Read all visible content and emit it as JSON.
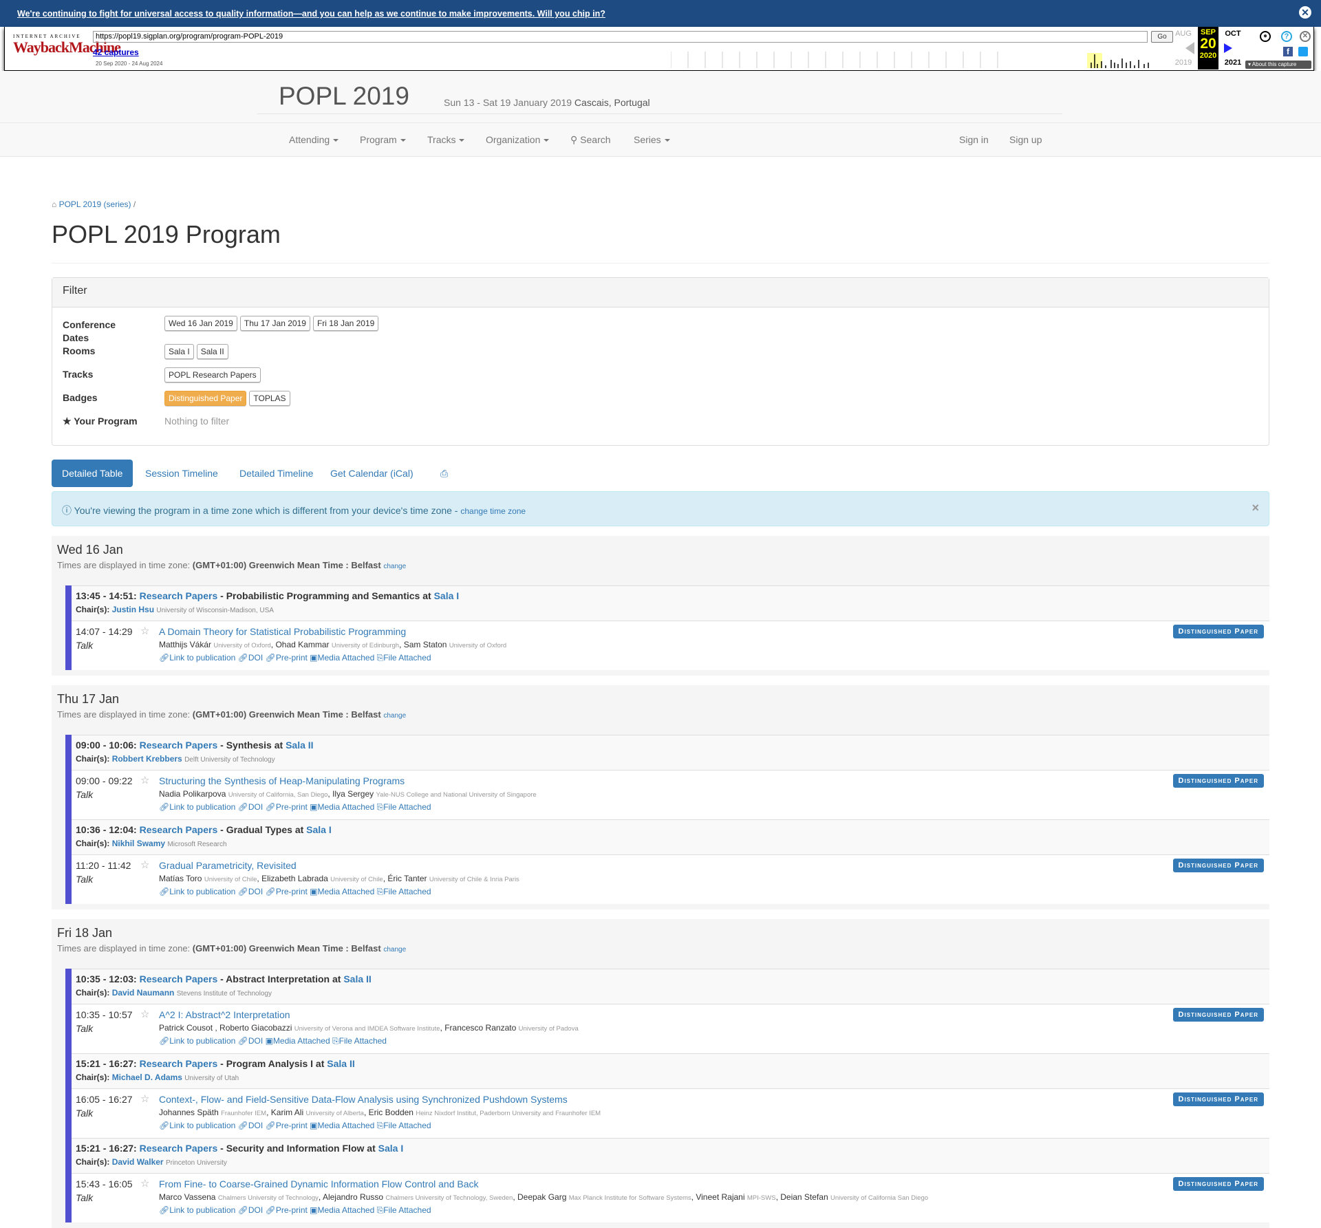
{
  "banner": {
    "text": "We're continuing to fight for universal access to quality information—and you can help as we continue to make improvements. Will you chip in?"
  },
  "wayback": {
    "ia": "INTERNET ARCHIVE",
    "wm": "WaybackMachine",
    "url": "https://popl19.sigplan.org/program/program-POPL-2019",
    "go": "Go",
    "captures": "42 captures",
    "range": "20 Sep 2020 - 24 Aug 2024",
    "prev_month": "AUG",
    "cur_month": "SEP",
    "next_month": "OCT",
    "cur_day": "20",
    "prev_year": "2019",
    "cur_year": "2020",
    "next_year": "2021",
    "about": "About this capture"
  },
  "site": {
    "title": "POPL 2019",
    "dates": "Sun 13 - Sat 19 January 2019",
    "location": "Cascais, Portugal",
    "nav": [
      "Attending",
      "Program",
      "Tracks",
      "Organization",
      "Search",
      "Series"
    ],
    "sign_in": "Sign in",
    "sign_up": "Sign up"
  },
  "crumb": "POPL 2019 (series)",
  "crumb_sep": "/",
  "page_title": "POPL 2019 Program",
  "filter": {
    "title": "Filter",
    "dates_label": "Conference Dates",
    "dates": [
      "Wed 16 Jan 2019",
      "Thu 17 Jan 2019",
      "Fri 18 Jan 2019"
    ],
    "rooms_label": "Rooms",
    "rooms": [
      "Sala I",
      "Sala II"
    ],
    "tracks_label": "Tracks",
    "tracks": [
      "POPL Research Papers"
    ],
    "badges_label": "Badges",
    "badges": [
      "Distinguished Paper",
      "TOPLAS"
    ],
    "your_label": "Your Program",
    "your_val": "Nothing to filter"
  },
  "tabs": [
    "Detailed Table",
    "Session Timeline",
    "Detailed Timeline",
    "Get Calendar (iCal)"
  ],
  "alert": {
    "text": "You're viewing the program in a time zone which is different from your device's time zone - ",
    "link": "change time zone"
  },
  "tz": {
    "prefix": "Times are displayed in time zone: ",
    "zone": "(GMT+01:00) Greenwich Mean Time : Belfast",
    "change": "change"
  },
  "links": {
    "pub": "Link to publication",
    "doi": "DOI",
    "pre": "Pre-print",
    "media": "Media Attached",
    "file": "File Attached",
    "chair": "Chair(s):",
    "talk": "Talk",
    "badge": "Distinguished Paper",
    "at": "at",
    "track": "Research Papers"
  },
  "days": [
    {
      "name": "Wed 16 Jan",
      "sessions": [
        {
          "time": "13:45 - 14:51:",
          "title": "Probabilistic Programming and Semantics",
          "room": "Sala I",
          "chair": "Justin Hsu",
          "chair_aff": "University of Wisconsin-Madison, USA",
          "event": {
            "time": "14:07 - 14:29",
            "title": "A Domain Theory for Statistical Probabilistic Programming",
            "authors": [
              [
                "Matthijs Vákár",
                "University of Oxford"
              ],
              [
                "Ohad Kammar",
                "University of Edinburgh"
              ],
              [
                "Sam Staton",
                "University of Oxford"
              ]
            ],
            "preprint": true
          }
        }
      ]
    },
    {
      "name": "Thu 17 Jan",
      "sessions": [
        {
          "time": "09:00 - 10:06:",
          "title": "Synthesis",
          "room": "Sala II",
          "chair": "Robbert Krebbers",
          "chair_aff": "Delft University of Technology",
          "event": {
            "time": "09:00 - 09:22",
            "title": "Structuring the Synthesis of Heap-Manipulating Programs",
            "authors": [
              [
                "Nadia Polikarpova",
                "University of California, San Diego"
              ],
              [
                "Ilya Sergey",
                "Yale-NUS College and National University of Singapore"
              ]
            ],
            "preprint": true
          }
        },
        {
          "time": "10:36 - 12:04:",
          "title": "Gradual Types",
          "room": "Sala I",
          "chair": "Nikhil Swamy",
          "chair_aff": "Microsoft Research",
          "event": {
            "time": "11:20 - 11:42",
            "title": "Gradual Parametricity, Revisited",
            "authors": [
              [
                "Matías Toro",
                "University of Chile"
              ],
              [
                "Elizabeth Labrada",
                "University of Chile"
              ],
              [
                "Éric Tanter",
                "University of Chile & Inria Paris"
              ]
            ],
            "preprint": true
          }
        }
      ]
    },
    {
      "name": "Fri 18 Jan",
      "sessions": [
        {
          "time": "10:35 - 12:03:",
          "title": "Abstract Interpretation",
          "room": "Sala II",
          "chair": "David Naumann",
          "chair_aff": "Stevens Institute of Technology",
          "event": {
            "time": "10:35 - 10:57",
            "title": "A^2 I: Abstract^2 Interpretation",
            "authors": [
              [
                "Patrick Cousot",
                ""
              ],
              [
                "Roberto Giacobazzi",
                "University of Verona and IMDEA Software Institute"
              ],
              [
                "Francesco Ranzato",
                "University of Padova"
              ]
            ],
            "preprint": false
          }
        },
        {
          "time": "15:21 - 16:27:",
          "title": "Program Analysis I",
          "room": "Sala II",
          "chair": "Michael D. Adams",
          "chair_aff": "University of Utah",
          "event": {
            "time": "16:05 - 16:27",
            "title": "Context-, Flow- and Field-Sensitive Data-Flow Analysis using Synchronized Pushdown Systems",
            "authors": [
              [
                "Johannes Späth",
                "Fraunhofer IEM"
              ],
              [
                "Karim Ali",
                "University of Alberta"
              ],
              [
                "Eric Bodden",
                "Heinz Nixdorf Institut, Paderborn University and Fraunhofer IEM"
              ]
            ],
            "preprint": true
          }
        },
        {
          "time": "15:21 - 16:27:",
          "title": "Security and Information Flow",
          "room": "Sala I",
          "chair": "David Walker",
          "chair_aff": "Princeton University",
          "event": {
            "time": "15:43 - 16:05",
            "title": "From Fine- to Coarse-Grained Dynamic Information Flow Control and Back",
            "authors": [
              [
                "Marco Vassena",
                "Chalmers University of Technology"
              ],
              [
                "Alejandro Russo",
                "Chalmers University of Technology, Sweden"
              ],
              [
                "Deepak Garg",
                "Max Planck Institute for Software Systems"
              ],
              [
                "Vineet Rajani",
                "MPI-SWS"
              ],
              [
                "Deian Stefan",
                "University of California San Diego"
              ]
            ],
            "preprint": true
          }
        }
      ]
    }
  ]
}
